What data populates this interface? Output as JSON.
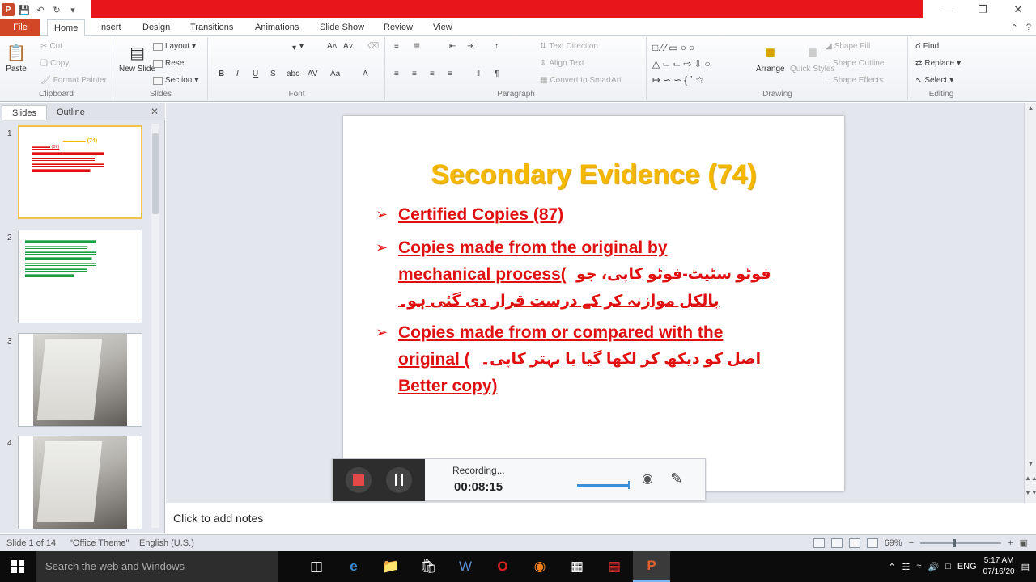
{
  "titlebar": {
    "window_controls": [
      "minimize-icon",
      "maximize-icon",
      "close-icon"
    ]
  },
  "tabs": {
    "file": "File",
    "items": [
      "Home",
      "Insert",
      "Design",
      "Transitions",
      "Animations",
      "Slide Show",
      "Review",
      "View"
    ],
    "active": "Home"
  },
  "ribbon": {
    "clipboard": {
      "label": "Clipboard",
      "paste": "Paste",
      "cut": "Cut",
      "copy": "Copy",
      "format_painter": "Format Painter"
    },
    "slides": {
      "label": "Slides",
      "new_slide": "New Slide",
      "layout": "Layout",
      "reset": "Reset",
      "section": "Section"
    },
    "font": {
      "label": "Font"
    },
    "paragraph": {
      "label": "Paragraph",
      "text_direction": "Text Direction",
      "align_text": "Align Text",
      "convert_smartart": "Convert to SmartArt"
    },
    "drawing": {
      "label": "Drawing",
      "arrange": "Arrange",
      "quick_styles": "Quick Styles",
      "shape_fill": "Shape Fill",
      "shape_outline": "Shape Outline",
      "shape_effects": "Shape Effects"
    },
    "editing": {
      "label": "Editing",
      "find": "Find",
      "replace": "Replace",
      "select": "Select"
    }
  },
  "leftpane": {
    "tab_slides": "Slides",
    "tab_outline": "Outline",
    "thumbs": [
      {
        "num": "1"
      },
      {
        "num": "2"
      },
      {
        "num": "3"
      },
      {
        "num": "4"
      }
    ]
  },
  "slide": {
    "title": "Secondary Evidence (74)",
    "bullets": [
      {
        "line1": "Certified Copies (87)"
      },
      {
        "line1": "Copies made from the original by",
        "line2_en": "mechanical process(",
        "line2_ur": "فوٹو سٹیٹ-فوٹو کاپی، جو",
        "line3_ur": "بالکل موازنہ کر کے درست قرار دی گئی ہو۔"
      },
      {
        "line1": "Copies made from or compared with the",
        "line2_en": "original (",
        "line2_ur": "اصل کو دیکھ کر لکھا گیا یا بہتر کاپی۔",
        "line3_en": "Better copy)"
      }
    ]
  },
  "recorder": {
    "status": "Recording...",
    "time": "00:08:15",
    "volume": 0.9
  },
  "notes": {
    "placeholder": "Click to add notes"
  },
  "statusbar": {
    "slide_info": "Slide 1 of 14",
    "theme": "\"Office Theme\"",
    "language": "English (U.S.)",
    "zoom": "69%"
  },
  "taskbar": {
    "search_placeholder": "Search the web and Windows",
    "language": "ENG",
    "time": "5:17 AM",
    "date": "07/16/20",
    "apps": [
      "task-view-icon",
      "edge-icon",
      "file-explorer-icon",
      "store-icon",
      "word-icon",
      "opera-icon",
      "firefox-icon",
      "photos-icon",
      "acrobat-icon",
      "powerpoint-icon"
    ]
  }
}
